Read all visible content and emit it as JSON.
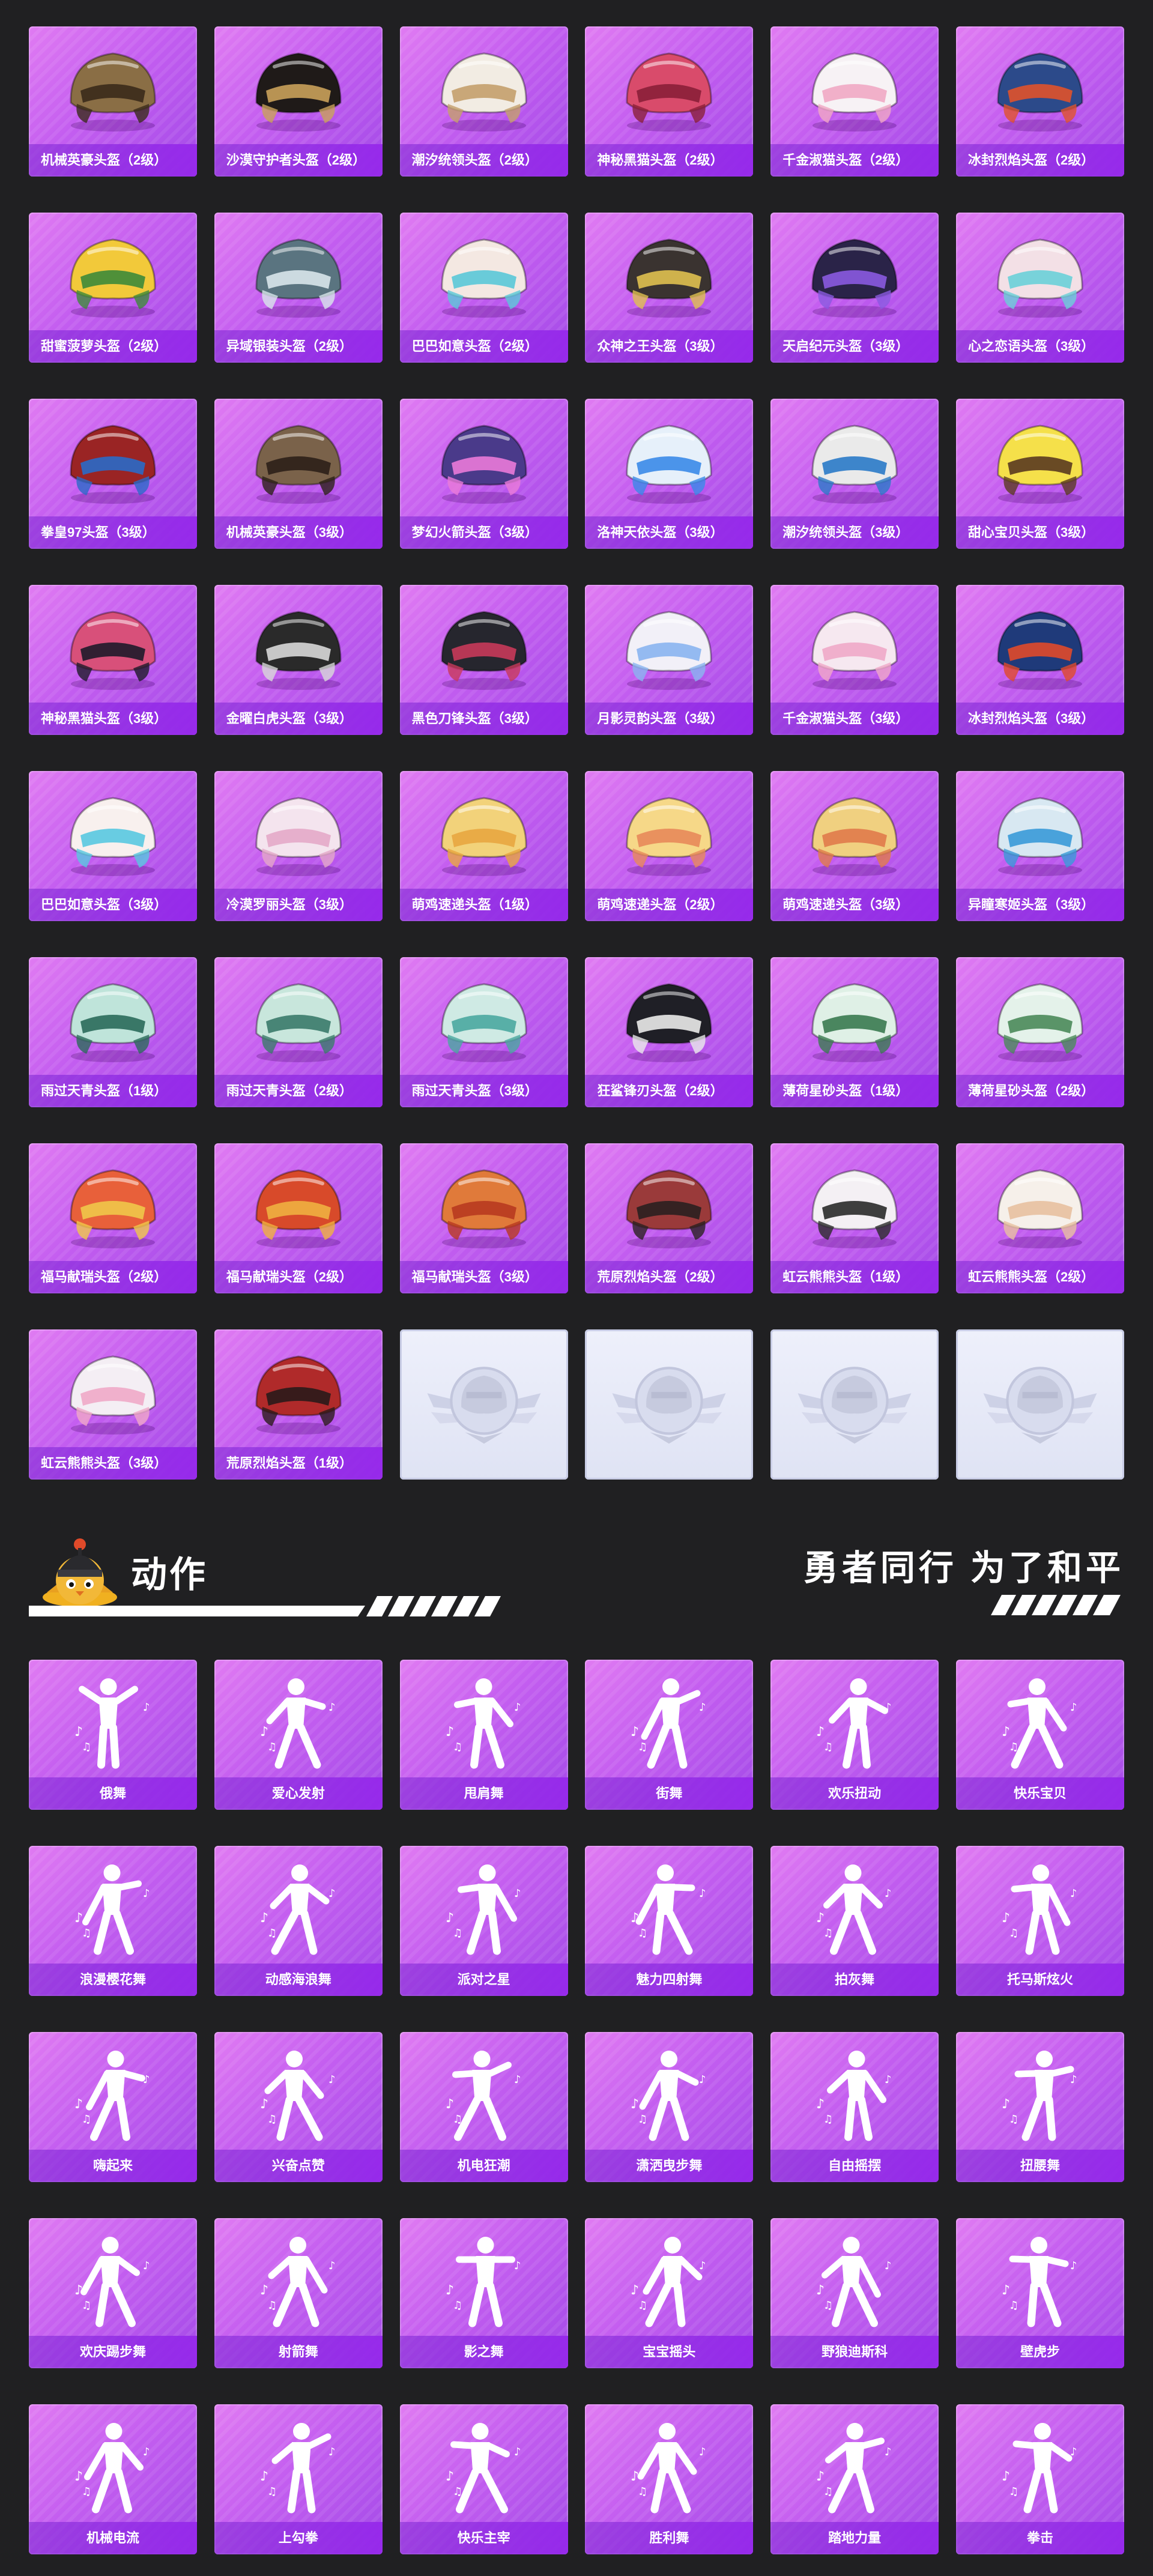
{
  "helmets": [
    {
      "name": "机械英豪头盔（2级）",
      "icon": "helmet-icon",
      "color": "#8a6e45",
      "accent": "#3a2a1a"
    },
    {
      "name": "沙漠守护者头盔（2级）",
      "icon": "helmet-icon",
      "color": "#1f1a18",
      "accent": "#c9a15a"
    },
    {
      "name": "潮汐统领头盔（2级）",
      "icon": "helmet-icon",
      "color": "#f2ece3",
      "accent": "#c4a06b"
    },
    {
      "name": "神秘黑猫头盔（2级）",
      "icon": "helmet-icon",
      "color": "#d94b6b",
      "accent": "#8a1f38"
    },
    {
      "name": "千金淑猫头盔（2级）",
      "icon": "helmet-icon",
      "color": "#f7f2f5",
      "accent": "#f0a8c4"
    },
    {
      "name": "冰封烈焰头盔（2级）",
      "icon": "helmet-icon",
      "color": "#2c4a8a",
      "accent": "#e0522a"
    },
    {
      "name": "甜蜜菠萝头盔（2级）",
      "icon": "helmet-icon",
      "color": "#f2c93a",
      "accent": "#3d8a3a"
    },
    {
      "name": "异域银装头盔（2级）",
      "icon": "helmet-icon",
      "color": "#5a7480",
      "accent": "#d8e6ea"
    },
    {
      "name": "巴巴如意头盔（2级）",
      "icon": "helmet-icon",
      "color": "#f4e8e2",
      "accent": "#5ac8d8"
    },
    {
      "name": "众神之王头盔（3级）",
      "icon": "helmet-icon",
      "color": "#3a3330",
      "accent": "#e0c050"
    },
    {
      "name": "天启纪元头盔（3级）",
      "icon": "helmet-icon",
      "color": "#2a2348",
      "accent": "#8a5ae0"
    },
    {
      "name": "心之恋语头盔（3级）",
      "icon": "helmet-icon",
      "color": "#f3e0e6",
      "accent": "#6ad0d8"
    },
    {
      "name": "拳皇97头盔（3级）",
      "icon": "helmet-icon",
      "color": "#9a2424",
      "accent": "#2a6ac8"
    },
    {
      "name": "机械英豪头盔（3级）",
      "icon": "helmet-icon",
      "color": "#7a624a",
      "accent": "#2c2018"
    },
    {
      "name": "梦幻火箭头盔（3级）",
      "icon": "helmet-icon",
      "color": "#4a3a8a",
      "accent": "#ea7ad8"
    },
    {
      "name": "洛神天依头盔（3级）",
      "icon": "helmet-icon",
      "color": "#e6f0fa",
      "accent": "#3a8ae8"
    },
    {
      "name": "潮汐统领头盔（3级）",
      "icon": "helmet-icon",
      "color": "#eaeaea",
      "accent": "#2a7ac8"
    },
    {
      "name": "甜心宝贝头盔（3级）",
      "icon": "helmet-icon",
      "color": "#f5e04a",
      "accent": "#5a3a20"
    },
    {
      "name": "神秘黑猫头盔（3级）",
      "icon": "helmet-icon",
      "color": "#d8507a",
      "accent": "#1f1a2a"
    },
    {
      "name": "金曜白虎头盔（3级）",
      "icon": "helmet-icon",
      "color": "#2a2a2a",
      "accent": "#d8d8d8"
    },
    {
      "name": "黑色刀锋头盔（3级）",
      "icon": "helmet-icon",
      "color": "#26262e",
      "accent": "#c83a5a"
    },
    {
      "name": "月影灵韵头盔（3级）",
      "icon": "helmet-icon",
      "color": "#f2f0f8",
      "accent": "#8ab4f0"
    },
    {
      "name": "千金淑猫头盔（3级）",
      "icon": "helmet-icon",
      "color": "#f6e8f0",
      "accent": "#f0a8c8"
    },
    {
      "name": "冰封烈焰头盔（3级）",
      "icon": "helmet-icon",
      "color": "#1f3a7a",
      "accent": "#e04a2a"
    },
    {
      "name": "巴巴如意头盔（3级）",
      "icon": "helmet-icon",
      "color": "#f8f0ee",
      "accent": "#58c8e0"
    },
    {
      "name": "冷漠罗丽头盔（3级）",
      "icon": "helmet-icon",
      "color": "#f4e4ee",
      "accent": "#e4a8c8"
    },
    {
      "name": "萌鸡速递头盔（1级）",
      "icon": "helmet-icon",
      "color": "#f2d27a",
      "accent": "#e8a640"
    },
    {
      "name": "萌鸡速递头盔（2级）",
      "icon": "helmet-icon",
      "color": "#f6d888",
      "accent": "#e88a5a"
    },
    {
      "name": "萌鸡速递头盔（3级）",
      "icon": "helmet-icon",
      "color": "#f0d080",
      "accent": "#e07a4a"
    },
    {
      "name": "异瞳寒姬头盔（3级）",
      "icon": "helmet-icon",
      "color": "#d8e8f2",
      "accent": "#3a9ad8"
    },
    {
      "name": "雨过天青头盔（1级）",
      "icon": "helmet-icon",
      "color": "#bfe4da",
      "accent": "#2a6a5a"
    },
    {
      "name": "雨过天青头盔（2级）",
      "icon": "helmet-icon",
      "color": "#c8e6dc",
      "accent": "#3a7a6a"
    },
    {
      "name": "雨过天青头盔（3级）",
      "icon": "helmet-icon",
      "color": "#cfeae4",
      "accent": "#4aa8a0"
    },
    {
      "name": "狂鲨锋刃头盔（2级）",
      "icon": "helmet-icon",
      "color": "#1f1f26",
      "accent": "#eaeaea"
    },
    {
      "name": "薄荷星砂头盔（1级）",
      "icon": "helmet-icon",
      "color": "#dff0e6",
      "accent": "#3a7a50"
    },
    {
      "name": "薄荷星砂头盔（2级）",
      "icon": "helmet-icon",
      "color": "#e4f2ea",
      "accent": "#4a8a5a"
    },
    {
      "name": "福马献瑞头盔（2级）",
      "icon": "helmet-icon",
      "color": "#e8603a",
      "accent": "#f0c84a"
    },
    {
      "name": "福马献瑞头盔（2级）",
      "icon": "helmet-icon",
      "color": "#d84a2a",
      "accent": "#f0b040"
    },
    {
      "name": "福马献瑞头盔（3级）",
      "icon": "helmet-icon",
      "color": "#e07a3a",
      "accent": "#b83a20"
    },
    {
      "name": "荒原烈焰头盔（2级）",
      "icon": "helmet-icon",
      "color": "#9a3a3a",
      "accent": "#2a2020"
    },
    {
      "name": "虹云熊熊头盔（1级）",
      "icon": "helmet-icon",
      "color": "#f4f0f4",
      "accent": "#2a2a2a"
    },
    {
      "name": "虹云熊熊头盔（2级）",
      "icon": "helmet-icon",
      "color": "#f6f0ea",
      "accent": "#e8c0a0"
    },
    {
      "name": "虹云熊熊头盔（3级）",
      "icon": "helmet-icon",
      "color": "#f4eef4",
      "accent": "#f0a8c8"
    },
    {
      "name": "荒原烈焰头盔（1级）",
      "icon": "helmet-icon",
      "color": "#b02a2a",
      "accent": "#2a1a1a"
    }
  ],
  "empty_slots": 4,
  "section": {
    "title": "动作",
    "slogan": "勇者同行 为了和平",
    "mascot_icon": "chicken-mascot-icon"
  },
  "emotes": [
    {
      "name": "俄舞",
      "icon": "dancer-silhouette-icon"
    },
    {
      "name": "爱心发射",
      "icon": "dancer-silhouette-icon"
    },
    {
      "name": "甩肩舞",
      "icon": "dancer-silhouette-icon"
    },
    {
      "name": "街舞",
      "icon": "dancer-silhouette-icon"
    },
    {
      "name": "欢乐扭动",
      "icon": "dancer-silhouette-icon"
    },
    {
      "name": "快乐宝贝",
      "icon": "dancer-silhouette-icon"
    },
    {
      "name": "浪漫樱花舞",
      "icon": "dancer-silhouette-icon"
    },
    {
      "name": "动感海浪舞",
      "icon": "dancer-silhouette-icon"
    },
    {
      "name": "派对之星",
      "icon": "dancer-silhouette-icon"
    },
    {
      "name": "魅力四射舞",
      "icon": "dancer-silhouette-icon"
    },
    {
      "name": "拍灰舞",
      "icon": "dancer-silhouette-icon"
    },
    {
      "name": "托马斯炫火",
      "icon": "dancer-silhouette-icon"
    },
    {
      "name": "嗨起来",
      "icon": "dancer-silhouette-icon"
    },
    {
      "name": "兴奋点赞",
      "icon": "dancer-silhouette-icon"
    },
    {
      "name": "机电狂潮",
      "icon": "dancer-silhouette-icon"
    },
    {
      "name": "潇洒曳步舞",
      "icon": "dancer-silhouette-icon"
    },
    {
      "name": "自由摇摆",
      "icon": "dancer-silhouette-icon"
    },
    {
      "name": "扭腰舞",
      "icon": "dancer-silhouette-icon"
    },
    {
      "name": "欢庆踢步舞",
      "icon": "dancer-silhouette-icon"
    },
    {
      "name": "射箭舞",
      "icon": "dancer-silhouette-icon"
    },
    {
      "name": "影之舞",
      "icon": "dancer-silhouette-icon"
    },
    {
      "name": "宝宝摇头",
      "icon": "dancer-silhouette-icon"
    },
    {
      "name": "野狼迪斯科",
      "icon": "dancer-silhouette-icon"
    },
    {
      "name": "壁虎步",
      "icon": "dancer-silhouette-icon"
    },
    {
      "name": "机械电流",
      "icon": "dancer-silhouette-icon"
    },
    {
      "name": "上勾拳",
      "icon": "dancer-silhouette-icon"
    },
    {
      "name": "快乐主宰",
      "icon": "dancer-silhouette-icon"
    },
    {
      "name": "胜利舞",
      "icon": "dancer-silhouette-icon"
    },
    {
      "name": "踏地力量",
      "icon": "dancer-silhouette-icon"
    },
    {
      "name": "拳击",
      "icon": "dancer-silhouette-icon"
    }
  ]
}
